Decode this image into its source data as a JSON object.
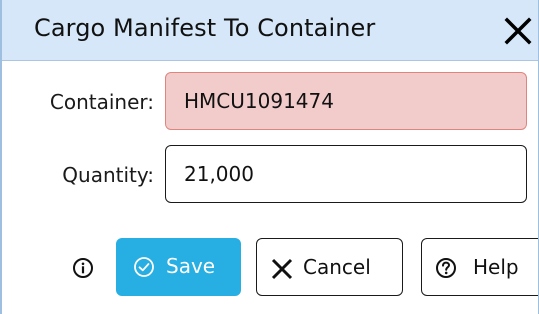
{
  "dialog": {
    "title": "Cargo Manifest To Container",
    "close_icon": "close-icon"
  },
  "form": {
    "container_label": "Container:",
    "container_value": "HMCU1091474",
    "quantity_label": "Quantity:",
    "quantity_value": "21,000"
  },
  "actions": {
    "info_icon": "info-icon",
    "save_label": "Save",
    "save_icon": "check-circle-icon",
    "cancel_label": "Cancel",
    "cancel_icon": "x-icon",
    "help_label": "Help",
    "help_icon": "question-circle-icon"
  },
  "colors": {
    "titlebar": "#d5e7f8",
    "container_error_bg": "#f2cccb",
    "container_error_border": "#e0847e",
    "save_button": "#27aee2"
  }
}
